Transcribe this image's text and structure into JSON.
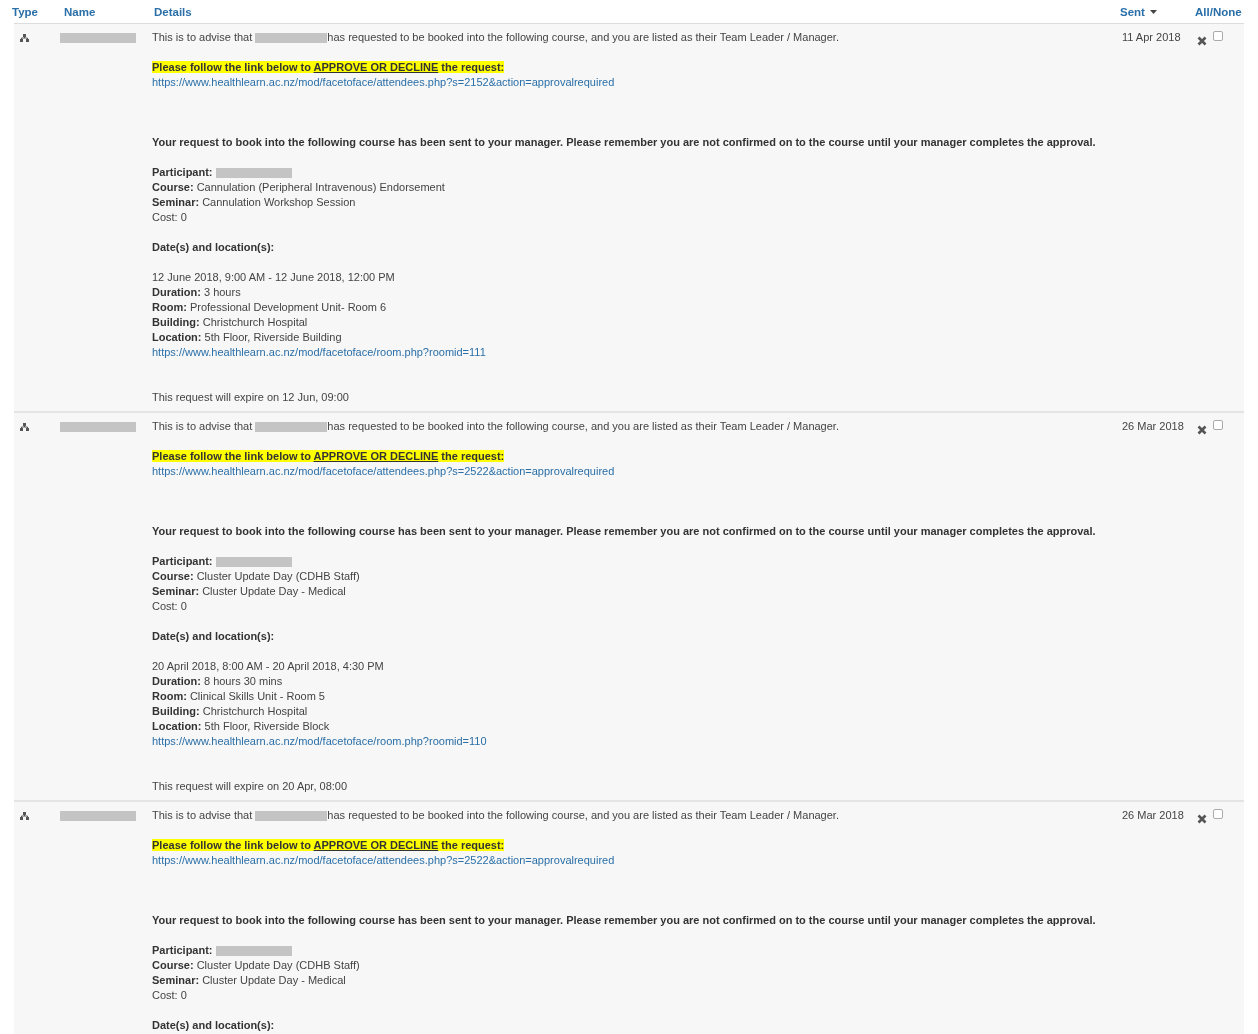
{
  "columns": [
    {
      "label": "Type"
    },
    {
      "label": "Name"
    },
    {
      "label": "Details"
    },
    {
      "label": "Sent",
      "sorted": true
    },
    {
      "label": "All/None"
    }
  ],
  "messages": [
    {
      "name": {
        "kind": "redacted"
      },
      "sent": "11 Apr 2018",
      "checked": false,
      "paragraphs": [
        {
          "kind": "intro",
          "lines": [
            {
              "kind": "advise",
              "before": "This is to advise that",
              "after": "has requested to be booked into the following course, and you are listed as their Team Leader / Manager."
            }
          ]
        },
        {
          "kind": "approval",
          "lines": [
            {
              "kind": "highlight",
              "before": "Please follow the link below to",
              "link": "APPROVE OR DECLINE",
              "after": "the request:"
            },
            {
              "kind": "link",
              "text": "https://www.healthlearn.ac.nz/mod/facetoface/attendees.php?s=2152&action=approvalrequired"
            }
          ]
        },
        {
          "kind": "notice",
          "lines": [
            {
              "kind": "bold",
              "text": "Your request to book into the following course has been sent to your manager. Please remember you are not confirmed on to the course until your manager completes the approval."
            }
          ]
        },
        {
          "kind": "booking",
          "lines": [
            {
              "kind": "redacted-field",
              "label": "Participant:"
            },
            {
              "kind": "field",
              "label": "Course:",
              "value": "Cannulation (Peripheral Intravenous) Endorsement"
            },
            {
              "kind": "field",
              "label": "Seminar:",
              "value": "Cannulation Workshop Session"
            },
            {
              "kind": "text",
              "text": "Cost: 0"
            }
          ]
        },
        {
          "kind": "heading",
          "lines": [
            {
              "kind": "bold",
              "text": "Date(s) and location(s):"
            }
          ]
        },
        {
          "kind": "session",
          "lines": [
            {
              "kind": "text",
              "text": "12 June 2018, 9:00 AM - 12 June 2018, 12:00 PM"
            },
            {
              "kind": "field",
              "label": "Duration:",
              "value": "3 hours"
            },
            {
              "kind": "field",
              "label": "Room:",
              "value": "Professional Development Unit- Room 6"
            },
            {
              "kind": "field",
              "label": "Building:",
              "value": "Christchurch Hospital"
            },
            {
              "kind": "field",
              "label": "Location:",
              "value": "5th Floor, Riverside Building"
            },
            {
              "kind": "link",
              "text": "https://www.healthlearn.ac.nz/mod/facetoface/room.php?roomid=111"
            }
          ]
        },
        {
          "kind": "expiry",
          "lines": [
            {
              "kind": "text",
              "text": "This request will expire on 12 Jun, 09:00"
            }
          ]
        }
      ]
    },
    {
      "name": {
        "kind": "redacted"
      },
      "sent": "26 Mar 2018",
      "checked": false,
      "paragraphs": [
        {
          "kind": "intro",
          "lines": [
            {
              "kind": "advise",
              "before": "This is to advise that",
              "after": "has requested to be booked into the following course, and you are listed as their Team Leader / Manager."
            }
          ]
        },
        {
          "kind": "approval",
          "lines": [
            {
              "kind": "highlight",
              "before": "Please follow the link below to",
              "link": "APPROVE OR DECLINE",
              "after": "the request:"
            },
            {
              "kind": "link",
              "text": "https://www.healthlearn.ac.nz/mod/facetoface/attendees.php?s=2522&action=approvalrequired"
            }
          ]
        },
        {
          "kind": "notice",
          "lines": [
            {
              "kind": "bold",
              "text": "Your request to book into the following course has been sent to your manager. Please remember you are not confirmed on to the course until your manager completes the approval."
            }
          ]
        },
        {
          "kind": "booking",
          "lines": [
            {
              "kind": "redacted-field",
              "label": "Participant:"
            },
            {
              "kind": "field",
              "label": "Course:",
              "value": "Cluster Update Day (CDHB Staff)"
            },
            {
              "kind": "field",
              "label": "Seminar:",
              "value": "Cluster Update Day - Medical"
            },
            {
              "kind": "text",
              "text": "Cost: 0"
            }
          ]
        },
        {
          "kind": "heading",
          "lines": [
            {
              "kind": "bold",
              "text": "Date(s) and location(s):"
            }
          ]
        },
        {
          "kind": "session",
          "lines": [
            {
              "kind": "text",
              "text": "20 April 2018, 8:00 AM - 20 April 2018, 4:30 PM"
            },
            {
              "kind": "field",
              "label": "Duration:",
              "value": "8 hours 30 mins"
            },
            {
              "kind": "field",
              "label": "Room:",
              "value": "Clinical Skills Unit - Room 5"
            },
            {
              "kind": "field",
              "label": "Building:",
              "value": "Christchurch Hospital"
            },
            {
              "kind": "field",
              "label": "Location:",
              "value": "5th Floor, Riverside Block"
            },
            {
              "kind": "link",
              "text": "https://www.healthlearn.ac.nz/mod/facetoface/room.php?roomid=110"
            }
          ]
        },
        {
          "kind": "expiry",
          "lines": [
            {
              "kind": "text",
              "text": "This request will expire on 20 Apr, 08:00"
            }
          ]
        }
      ]
    },
    {
      "name": {
        "kind": "redacted"
      },
      "sent": "26 Mar 2018",
      "checked": false,
      "paragraphs": [
        {
          "kind": "intro",
          "lines": [
            {
              "kind": "advise",
              "before": "This is to advise that",
              "after": "has requested to be booked into the following course, and you are listed as their Team Leader / Manager."
            }
          ]
        },
        {
          "kind": "approval",
          "lines": [
            {
              "kind": "highlight",
              "before": "Please follow the link below to",
              "link": "APPROVE OR DECLINE",
              "after": "the request:"
            },
            {
              "kind": "link",
              "text": "https://www.healthlearn.ac.nz/mod/facetoface/attendees.php?s=2522&action=approvalrequired"
            }
          ]
        },
        {
          "kind": "notice",
          "lines": [
            {
              "kind": "bold",
              "text": "Your request to book into the following course has been sent to your manager. Please remember you are not confirmed on to the course until your manager completes the approval."
            }
          ]
        },
        {
          "kind": "booking",
          "lines": [
            {
              "kind": "redacted-field",
              "label": "Participant:"
            },
            {
              "kind": "field",
              "label": "Course:",
              "value": "Cluster Update Day (CDHB Staff)"
            },
            {
              "kind": "field",
              "label": "Seminar:",
              "value": "Cluster Update Day - Medical"
            },
            {
              "kind": "text",
              "text": "Cost: 0"
            }
          ]
        },
        {
          "kind": "heading",
          "lines": [
            {
              "kind": "bold",
              "text": "Date(s) and location(s):"
            }
          ]
        }
      ]
    }
  ]
}
